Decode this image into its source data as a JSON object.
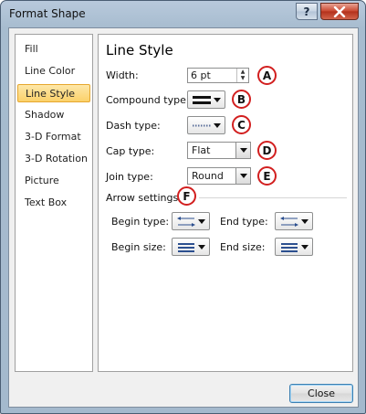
{
  "window": {
    "title": "Format Shape",
    "help_label": "?"
  },
  "nav": {
    "items": [
      {
        "label": "Fill",
        "selected": false
      },
      {
        "label": "Line Color",
        "selected": false
      },
      {
        "label": "Line Style",
        "selected": true
      },
      {
        "label": "Shadow",
        "selected": false
      },
      {
        "label": "3-D Format",
        "selected": false
      },
      {
        "label": "3-D Rotation",
        "selected": false
      },
      {
        "label": "Picture",
        "selected": false
      },
      {
        "label": "Text Box",
        "selected": false
      }
    ]
  },
  "panel": {
    "heading": "Line Style",
    "width": {
      "label": "Width:",
      "value": "6 pt",
      "callout": "A"
    },
    "compound": {
      "label": "Compound type:",
      "icon": "compound-lines-icon",
      "callout": "B"
    },
    "dash": {
      "label": "Dash type:",
      "icon": "dash-line-icon",
      "callout": "C"
    },
    "cap": {
      "label": "Cap type:",
      "value": "Flat",
      "callout": "D"
    },
    "join": {
      "label": "Join type:",
      "value": "Round",
      "callout": "E"
    },
    "arrow": {
      "heading": "Arrow settings",
      "callout": "F",
      "begin_type": {
        "label": "Begin type:",
        "icon": "arrow-type-icon"
      },
      "end_type": {
        "label": "End type:",
        "icon": "arrow-type-icon"
      },
      "begin_size": {
        "label": "Begin size:",
        "icon": "arrow-size-icon"
      },
      "end_size": {
        "label": "End size:",
        "icon": "arrow-size-icon"
      }
    }
  },
  "footer": {
    "close_label": "Close"
  },
  "colors": {
    "callout_ring": "#d21f1f",
    "selected_nav": "#fbd16a",
    "line_blue": "#2c4f8f"
  }
}
